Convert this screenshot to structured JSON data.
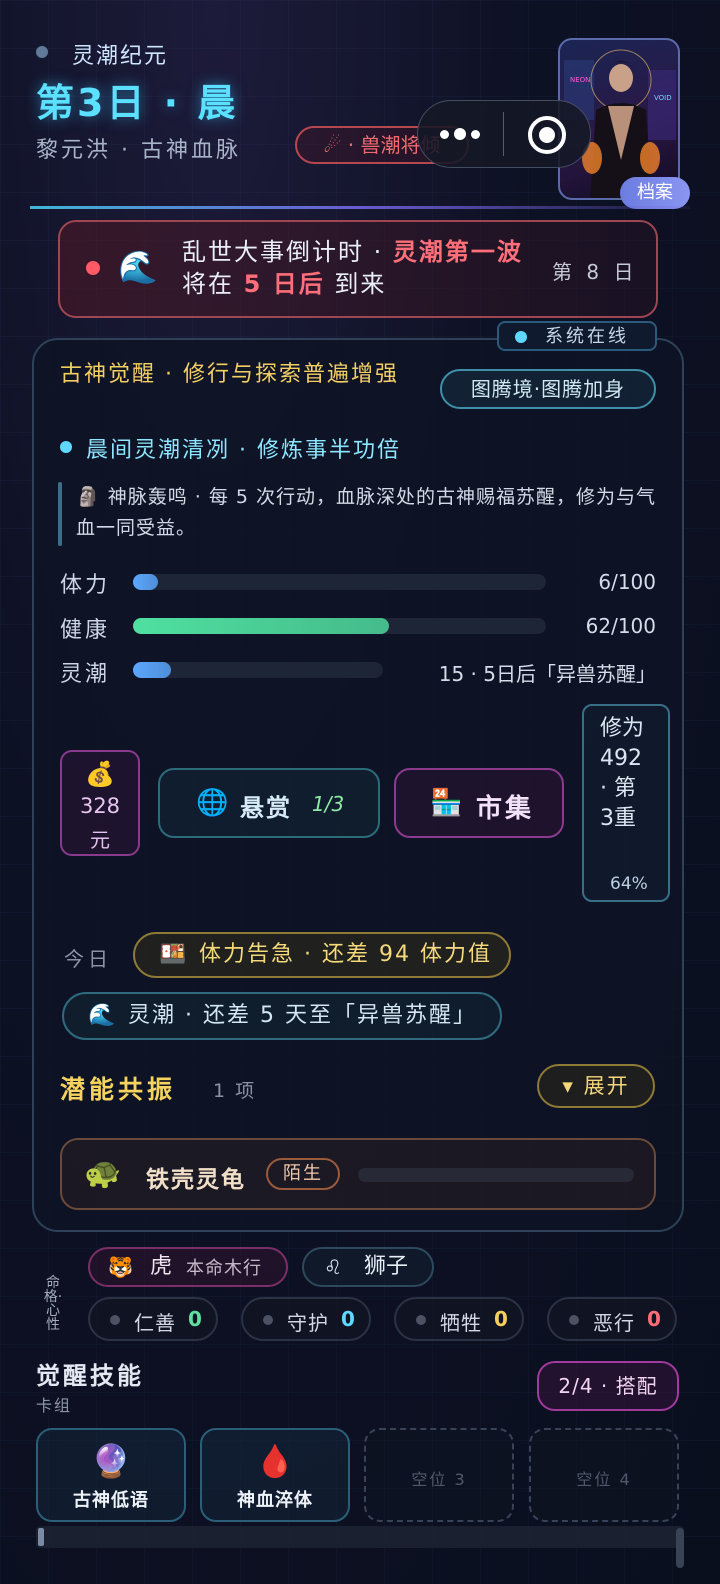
{
  "header": {
    "era": "灵潮纪元",
    "day": "第3日 · 晨",
    "bloodline": "黎元洪 · 古神血脉",
    "beast_tag": "☄ · 兽潮将倾",
    "archive_label": "档案"
  },
  "countdown": {
    "icon": "🌊",
    "part1": "乱世大事倒计时 · ",
    "highlight1": "灵潮第一波",
    "part2": " 将在 ",
    "highlight2": "5 日后",
    "part3": " 到来",
    "day_label": "第 8 日"
  },
  "system_status": "系统在线",
  "buff": {
    "title": "古神觉醒 · 修行与探索普遍增强",
    "totem_button": "图腾境·图腾加身",
    "tide_line": "晨间灵潮清冽 · 修炼事半功倍",
    "quote_icon": "🗿",
    "quote": "神脉轰鸣 · 每 5 次行动，血脉深处的古神赐福苏醒，修为与气血一同受益。"
  },
  "stats": [
    {
      "label": "体力",
      "value": "6/100",
      "fraction": 0.06,
      "color": "#5ba8ff"
    },
    {
      "label": "健康",
      "value": "62/100",
      "fraction": 0.62,
      "color": "#4fe0a0"
    },
    {
      "label": "灵潮",
      "value": "15 · 5日后「异兽苏醒」",
      "fraction": 0.15,
      "color": "#5ba8ff"
    }
  ],
  "money": {
    "icon": "💰",
    "amount": "328",
    "unit": "元"
  },
  "bounty": {
    "icon": "🌐",
    "label": "悬赏",
    "count": "1/3"
  },
  "market": {
    "icon": "🏪",
    "label": "市集"
  },
  "cultivation": {
    "text": "修为 492 · 第 3重",
    "percent": "64%"
  },
  "today": {
    "label": "今日",
    "chip1_icon": "🍱",
    "chip1": "体力告急 · 还差 94 体力值",
    "chip2_icon": "🌊",
    "chip2": "灵潮 · 还差 5 天至「异兽苏醒」"
  },
  "potential": {
    "title": "潜能共振",
    "count": "1 项",
    "expand": "▾ 展开",
    "item_icon": "🐢",
    "item_name": "铁壳灵龟",
    "item_tag": "陌生"
  },
  "fate": {
    "vertical_label": "命格·心性",
    "zodiac_icon": "🐯",
    "zodiac": "虎",
    "element": "本命木行",
    "star_icon": "♌",
    "star": "狮子",
    "virtues": [
      {
        "name": "仁善",
        "value": "0",
        "color": "#5fe0a0"
      },
      {
        "name": "守护",
        "value": "0",
        "color": "#5fd8ff"
      },
      {
        "name": "牺牲",
        "value": "0",
        "color": "#f5cf5a"
      },
      {
        "name": "恶行",
        "value": "0",
        "color": "#ff6b76"
      }
    ]
  },
  "skills": {
    "title": "觉醒技能",
    "subtitle": "卡组",
    "button": "2/4 · 搭配",
    "slots": [
      {
        "icon": "🔮",
        "name": "古神低语"
      },
      {
        "icon": "🩸",
        "name": "神血淬体"
      },
      {
        "empty": "空位 3"
      },
      {
        "empty": "空位 4"
      }
    ]
  }
}
